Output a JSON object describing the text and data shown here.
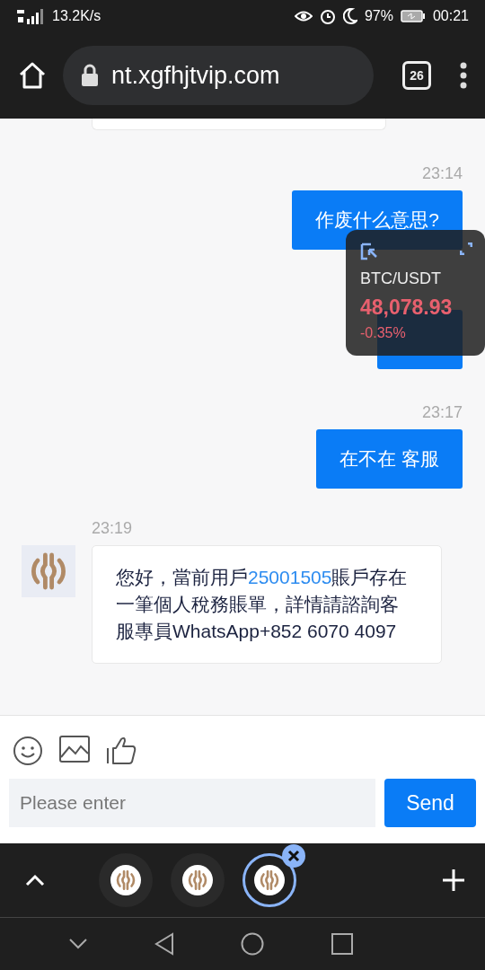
{
  "status_bar": {
    "network": "13.2K/s",
    "battery": "97%",
    "time": "00:21"
  },
  "browser": {
    "url": "nt.xgfhjtvip.com",
    "tab_count": "26"
  },
  "messages": [
    {
      "kind": "outgoing",
      "time": "23:14",
      "text": "作废什么意思?"
    },
    {
      "kind": "covered"
    },
    {
      "kind": "outgoing",
      "time": "23:17",
      "text": "在不在 客服"
    },
    {
      "kind": "incoming",
      "time": "23:19",
      "parts": [
        {
          "text": "您好，當前用戶"
        },
        {
          "text": "25001505",
          "kind": "link"
        },
        {
          "text": "賬戶存在一筆個人稅務賬單，詳情請諮詢客服專員WhatsApp+852 6070 4097"
        }
      ]
    }
  ],
  "ticker": {
    "pair": "BTC/USDT",
    "price": "48,078.93",
    "change": "-0.35%"
  },
  "composer": {
    "placeholder": "Please enter",
    "send": "Send"
  },
  "tab_strip": {
    "tabs": [
      {
        "selected": false
      },
      {
        "selected": false
      },
      {
        "selected": true
      }
    ]
  }
}
